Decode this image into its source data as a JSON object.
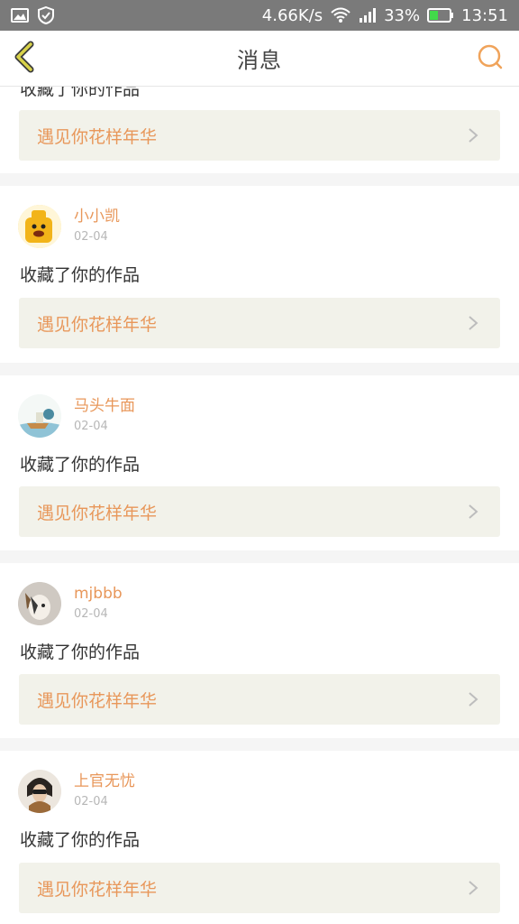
{
  "status_bar": {
    "network_speed": "4.66K/s",
    "battery_percent": "33%",
    "time": "13:51"
  },
  "header": {
    "title": "消息"
  },
  "notifications": [
    {
      "username": "",
      "date": "",
      "action": "收藏了你的作品",
      "work_title": "遇见你花样年华"
    },
    {
      "username": "小小凯",
      "date": "02-04",
      "action": "收藏了你的作品",
      "work_title": "遇见你花样年华"
    },
    {
      "username": "马头牛面",
      "date": "02-04",
      "action": "收藏了你的作品",
      "work_title": "遇见你花样年华"
    },
    {
      "username": "mjbbb",
      "date": "02-04",
      "action": "收藏了你的作品",
      "work_title": "遇见你花样年华"
    },
    {
      "username": "上官无忧",
      "date": "02-04",
      "action": "收藏了你的作品",
      "work_title": "遇见你花样年华"
    }
  ],
  "colors": {
    "accent": "#e8975a",
    "status_bar": "#7a7a7a",
    "battery": "#42d94a",
    "back_arrow": "#c8c24a",
    "link_bg": "#f2f2ea"
  }
}
